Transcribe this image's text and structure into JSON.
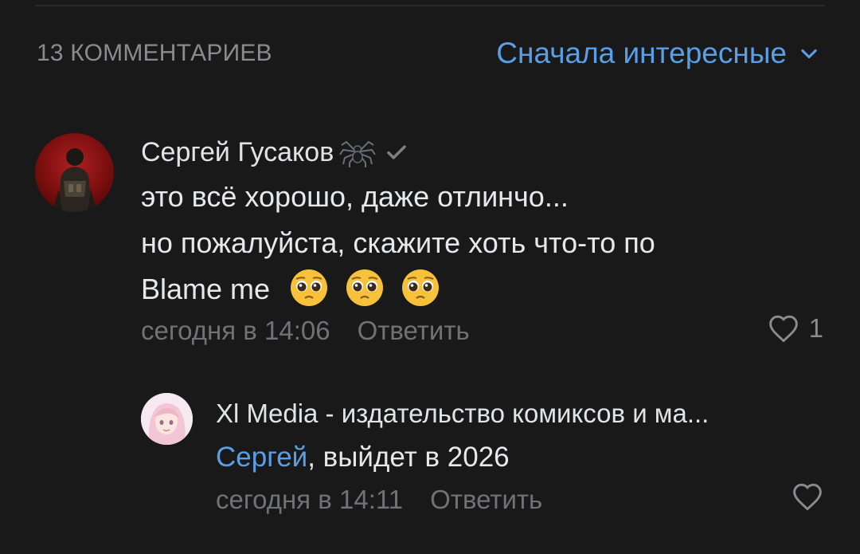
{
  "header": {
    "comments_count": "13 КОММЕНТАРИЕВ",
    "sort_label": "Сначала интересные"
  },
  "comments": [
    {
      "author": "Сергей Гусаков",
      "line1": "это всё хорошо, даже отлинчо...",
      "line2": "но пожалуйста, скажите хоть что-то по",
      "line3": "Blame me",
      "time": "сегодня в 14:06",
      "reply_label": "Ответить",
      "likes": "1"
    }
  ],
  "replies": [
    {
      "author": "Xl Media - издательство комиксов и ма...",
      "mention": "Сергей",
      "text": ", выйдет в 2026",
      "time": "сегодня в 14:11",
      "reply_label": "Ответить"
    }
  ],
  "icons": {
    "sort": "chevron-down-icon",
    "verified": "checkmark-icon",
    "spider": "spider-icon",
    "like": "heart-icon",
    "emoji": "pleading-face-emoji"
  },
  "colors": {
    "background": "#19191a",
    "accent": "#5a9ee6",
    "muted": "#717276"
  }
}
